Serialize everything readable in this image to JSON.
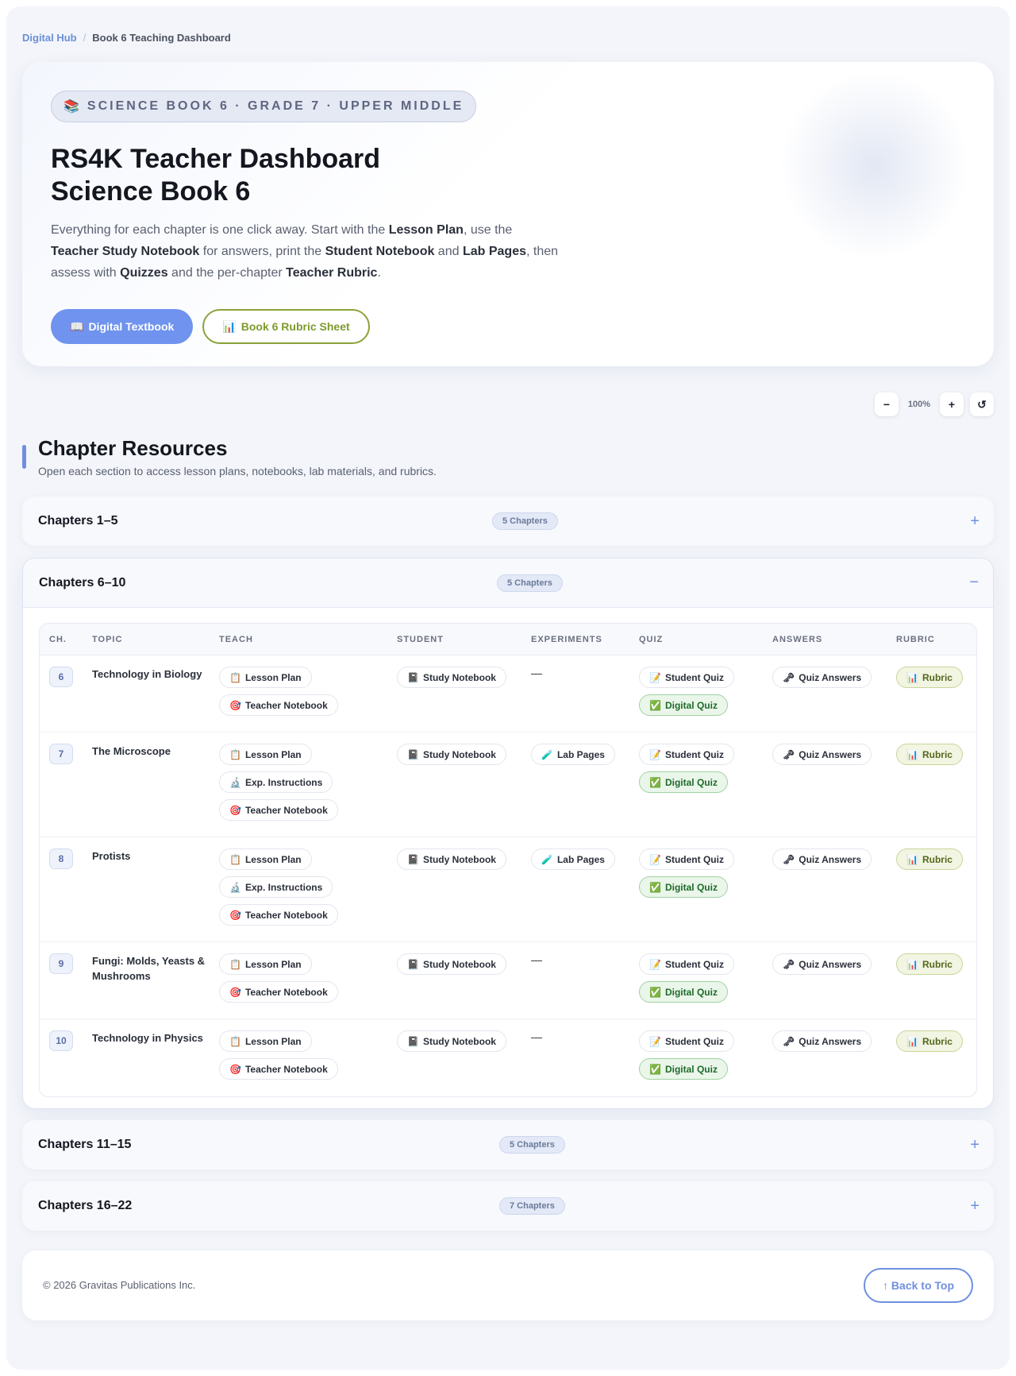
{
  "breadcrumb": {
    "home": "Digital Hub",
    "separator": "/",
    "current": "Book 6 Teaching Dashboard"
  },
  "hero": {
    "badge_icon": "📚",
    "badge": "SCIENCE BOOK 6 · GRADE 7 · UPPER MIDDLE",
    "title_line1": "RS4K Teacher Dashboard",
    "title_line2": "Science Book 6",
    "desc": {
      "t1": "Everything for each chapter is one click away. Start with the ",
      "b1": "Lesson Plan",
      "t2": ", use the ",
      "b2": "Teacher Study Notebook",
      "t3": " for answers, print the ",
      "b3": "Student Notebook",
      "t4": " and ",
      "b4": "Lab Pages",
      "t5": ", then assess with ",
      "b5": "Quizzes",
      "t6": " and the per-chapter ",
      "b6": "Teacher Rubric",
      "t7": "."
    },
    "btn_textbook_icon": "📖",
    "btn_textbook": "Digital Textbook",
    "btn_rubric_icon": "📊",
    "btn_rubric": "Book 6 Rubric Sheet"
  },
  "zoom": {
    "minus": "−",
    "level": "100%",
    "plus": "+",
    "reset": "↺"
  },
  "section": {
    "title": "Chapter Resources",
    "subtitle": "Open each section to access lesson plans, notebooks, lab materials, and rubrics."
  },
  "groups": [
    {
      "title": "Chapters 1–5",
      "count": "5 Chapters",
      "toggle": "+"
    },
    {
      "title": "Chapters 6–10",
      "count": "5 Chapters",
      "toggle": "−"
    },
    {
      "title": "Chapters 11–15",
      "count": "5 Chapters",
      "toggle": "+"
    },
    {
      "title": "Chapters 16–22",
      "count": "7 Chapters",
      "toggle": "+"
    }
  ],
  "table": {
    "headers": [
      "CH.",
      "TOPIC",
      "TEACH",
      "STUDENT",
      "EXPERIMENTS",
      "QUIZ",
      "ANSWERS",
      "RUBRIC"
    ],
    "icons": {
      "lesson": "📋",
      "exp": "🔬",
      "teacher": "🎯",
      "notebook": "📓",
      "lab": "🧪",
      "quiz": "📝",
      "digital": "✅",
      "answers": "🗝",
      "rubric": "📊"
    },
    "labels": {
      "lesson": "Lesson Plan",
      "exp": "Exp. Instructions",
      "teacher": "Teacher Notebook",
      "notebook": "Study Notebook",
      "lab": "Lab Pages",
      "quiz": "Student Quiz",
      "digital": "Digital Quiz",
      "answers": "Quiz Answers",
      "rubric": "Rubric",
      "none": "—"
    },
    "rows": [
      {
        "ch": "6",
        "topic": "Technology in Biology"
      },
      {
        "ch": "7",
        "topic": "The Microscope"
      },
      {
        "ch": "8",
        "topic": "Protists"
      },
      {
        "ch": "9",
        "topic": "Fungi: Molds, Yeasts & Mushrooms"
      },
      {
        "ch": "10",
        "topic": "Technology in Physics"
      }
    ]
  },
  "footer": {
    "copyright": "© 2026 Gravitas Publications Inc.",
    "back_to_top": "↑ Back to Top"
  }
}
